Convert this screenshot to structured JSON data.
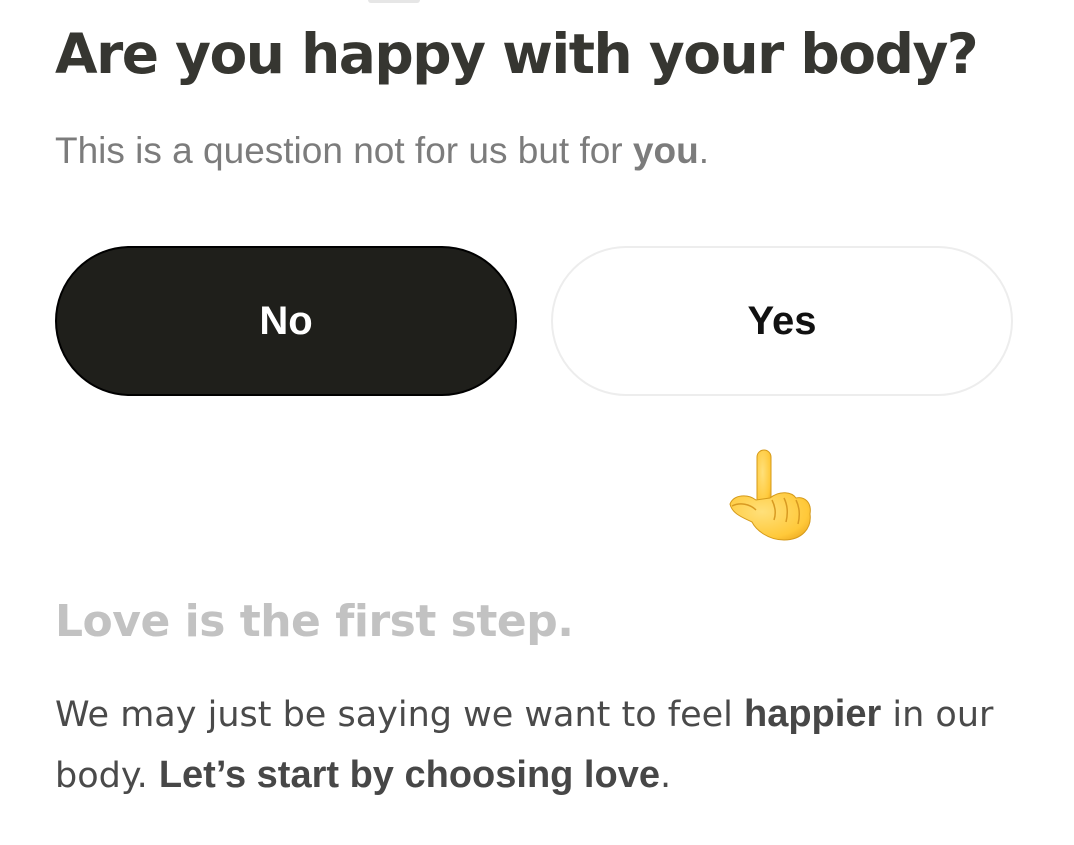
{
  "question": {
    "title": "Are you happy with your body?",
    "subtitle_pre": "This is a question not for us but for ",
    "subtitle_bold": "you",
    "subtitle_post": "."
  },
  "options": {
    "no_label": "No",
    "yes_label": "Yes",
    "selected": "No"
  },
  "hint_icon": "pointing-up-hand-icon",
  "message": {
    "heading": "Love is the first step.",
    "body_part1": "We may just be saying we want to feel ",
    "body_bold1": "happier",
    "body_part2": " in our body. ",
    "body_bold2": "Let’s start by choosing love",
    "body_part3": "."
  },
  "colors": {
    "selected_bg": "#1f1f1b",
    "title_color": "#363631",
    "muted_heading": "#c2c2c2"
  }
}
